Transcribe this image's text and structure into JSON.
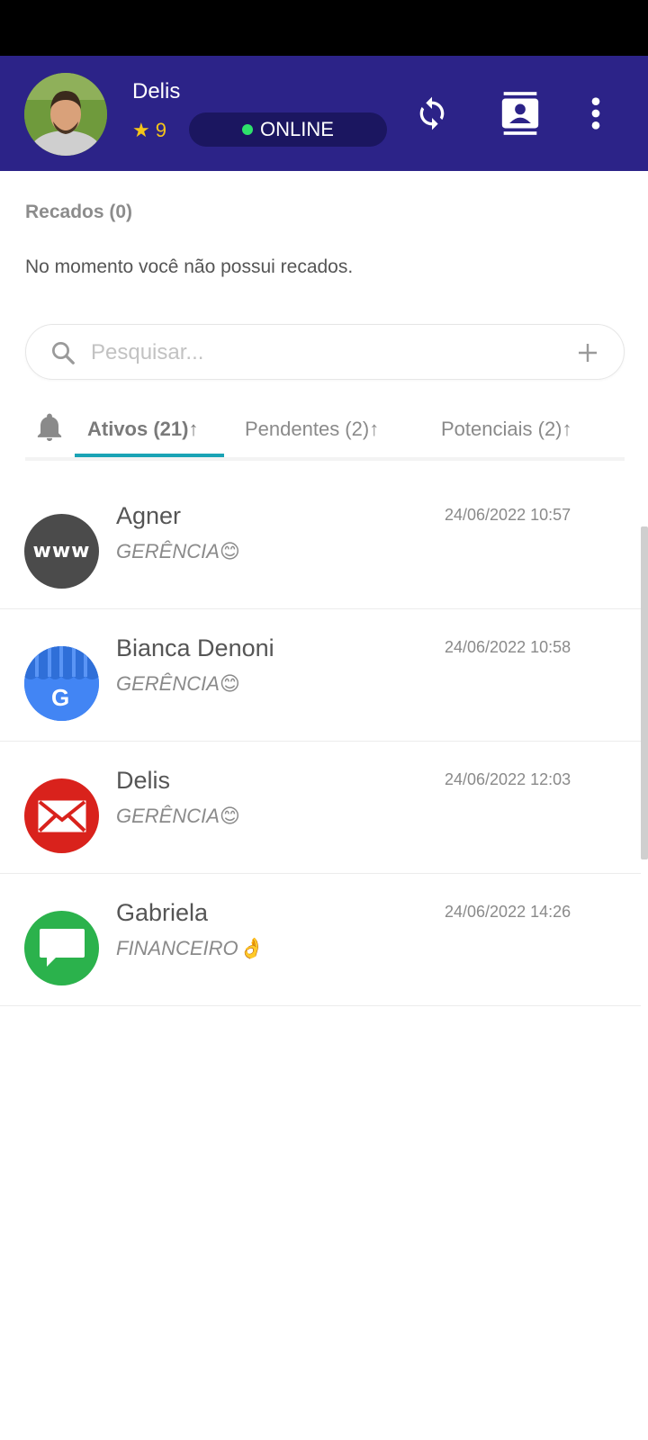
{
  "user": {
    "name": "Delis",
    "rating": "9",
    "status": "ONLINE"
  },
  "recados": {
    "title": "Recados (0)",
    "empty_message": "No momento você não possui recados."
  },
  "search": {
    "placeholder": "Pesquisar..."
  },
  "tabs": [
    {
      "label": "Ativos (21)↑",
      "active": true
    },
    {
      "label": "Pendentes (2)↑",
      "active": false
    },
    {
      "label": "Potenciais (2)↑",
      "active": false
    }
  ],
  "conversations": [
    {
      "name": "Agner",
      "department": "GERÊNCIA😊",
      "datetime": "24/06/2022 10:57",
      "icon": "www-icon",
      "avatar_label": "www"
    },
    {
      "name": "Bianca Denoni",
      "department": "GERÊNCIA😊",
      "datetime": "24/06/2022 10:58",
      "icon": "google-my-business-icon",
      "avatar_label": "G"
    },
    {
      "name": "Delis",
      "department": "GERÊNCIA😊",
      "datetime": "24/06/2022 12:03",
      "icon": "email-icon"
    },
    {
      "name": "Gabriela",
      "department": "FINANCEIRO👌",
      "datetime": "24/06/2022 14:26",
      "icon": "sms-chat-icon"
    }
  ],
  "colors": {
    "header_bg": "#2c2388",
    "status_pill_bg": "#1b1660",
    "online_dot": "#2ee26b",
    "star": "#f5c518",
    "tab_indicator": "#1aa3b5"
  }
}
